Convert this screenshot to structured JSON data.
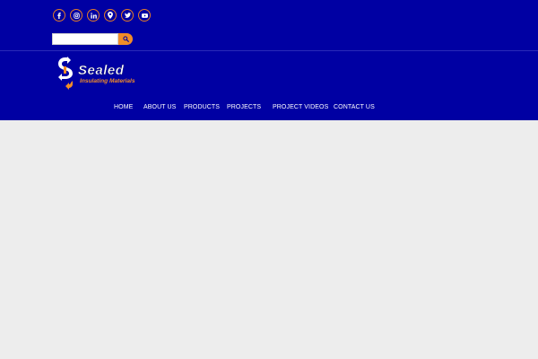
{
  "header": {
    "background_color": "#0000a3",
    "accent_color": "#f28c28",
    "social_icons": [
      "facebook-icon",
      "instagram-icon",
      "linkedin-icon",
      "map-pin-icon",
      "twitter-icon",
      "youtube-icon"
    ]
  },
  "search": {
    "value": "",
    "placeholder": ""
  },
  "logo": {
    "name": "Sealed",
    "tagline": "Insulating Materials"
  },
  "nav": {
    "items": [
      "HOME",
      "ABOUT US",
      "PRODUCTS",
      "PROJECTS",
      "PROJECT VIDEOS",
      "CONTACT US"
    ]
  }
}
